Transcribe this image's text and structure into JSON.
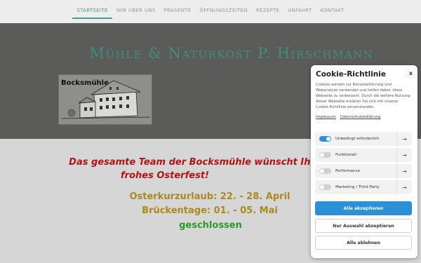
{
  "nav": {
    "items": [
      {
        "label": "Startseite"
      },
      {
        "label": "Wir über uns"
      },
      {
        "label": "Präsente"
      },
      {
        "label": "Öffnungszeiten"
      },
      {
        "label": "Rezepte"
      },
      {
        "label": "Anfahrt"
      },
      {
        "label": "Kontakt"
      }
    ],
    "active_index": 0
  },
  "header": {
    "title": "Mühle & Naturkost P. Hirschmann",
    "logo_text": "Bocksmühle"
  },
  "main": {
    "greeting_line1": "Das gesamte Team der Bocksmühle wünscht Ihnen",
    "greeting_line2": "frohes Osterfest!",
    "info_line1": "Osterkurzurlaub: 22. - 28. April",
    "info_line2": "Brückentage: 01. - 05. Mai",
    "info_line3": "geschlossen"
  },
  "cookie": {
    "title": "Cookie-Richtlinie",
    "close": "x",
    "text": "Cookies werden zur Benutzerführung und Webanalyse verwendet und helfen dabei, diese Webseite zu verbessern. Durch die weitere Nutzung dieser Webseite erklären Sie sich mit unserer Cookie-Richtlinie einverstanden.",
    "link_impressum": "Impressum",
    "link_privacy": "Datenschutzerklärung",
    "options": [
      {
        "label": "Unbedingt erforderlich",
        "enabled": true
      },
      {
        "label": "Funktionell",
        "enabled": false
      },
      {
        "label": "Performance",
        "enabled": false
      },
      {
        "label": "Marketing / Third Party",
        "enabled": false
      }
    ],
    "arrow": "→",
    "accept_all": "Alle akzeptieren",
    "accept_selection": "Nur Auswahl akzeptieren",
    "reject_all": "Alle ablehnen"
  },
  "colors": {
    "accent": "#4a9a8f",
    "brand": "#3f8c82",
    "header_band": "#5b5b59",
    "greeting": "#b01414",
    "info": "#a88a1f",
    "closed": "#2a9a2a",
    "button_primary": "#2b91d6"
  }
}
